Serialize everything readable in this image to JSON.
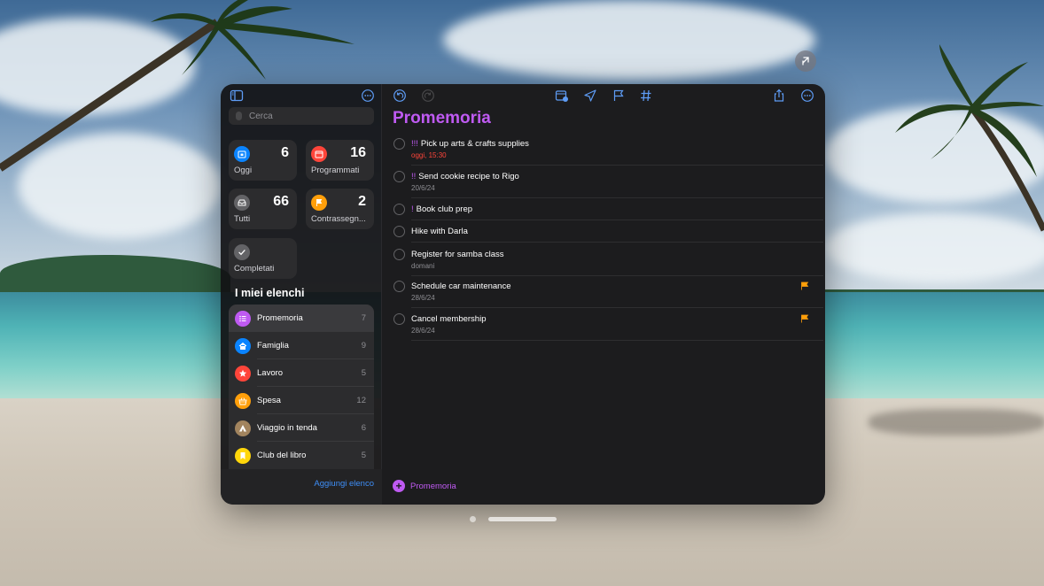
{
  "sidebar": {
    "search_placeholder": "Cerca",
    "tiles": [
      {
        "label": "Oggi",
        "count": "6",
        "color": "#0a84ff",
        "icon": "calendar-today-icon"
      },
      {
        "label": "Programmati",
        "count": "16",
        "color": "#ff453a",
        "icon": "calendar-icon"
      },
      {
        "label": "Tutti",
        "count": "66",
        "color": "#8e8e93",
        "icon": "tray-icon"
      },
      {
        "label": "Contrassegnati",
        "display_label": "Contrassegn...",
        "count": "2",
        "color": "#ff9f0a",
        "icon": "flag-icon"
      },
      {
        "label": "Completati",
        "count": "",
        "color": "#8e8e93",
        "icon": "checkmark-icon"
      }
    ],
    "section_title": "I miei elenchi",
    "lists": [
      {
        "name": "Promemoria",
        "count": "7",
        "color": "#bf5af2",
        "icon": "list-bullet-icon"
      },
      {
        "name": "Famiglia",
        "count": "9",
        "color": "#0a84ff",
        "icon": "house-icon"
      },
      {
        "name": "Lavoro",
        "count": "5",
        "color": "#ff453a",
        "icon": "star-icon"
      },
      {
        "name": "Spesa",
        "count": "12",
        "color": "#ff9f0a",
        "icon": "basket-icon"
      },
      {
        "name": "Viaggio in tenda",
        "count": "6",
        "color": "#a2845e",
        "icon": "tent-icon"
      },
      {
        "name": "Club del libro",
        "count": "5",
        "color": "#ffd60a",
        "icon": "bookmark-icon"
      }
    ],
    "add_list_label": "Aggiungi elenco"
  },
  "main": {
    "title": "Promemoria",
    "reminders": [
      {
        "priority": "!!!",
        "title": "Pick up arts & crafts supplies",
        "subtitle": "oggi, 15:30",
        "subtitle_red": true,
        "flagged": false
      },
      {
        "priority": "!!",
        "title": "Send cookie recipe to Rigo",
        "subtitle": "20/6/24",
        "subtitle_red": false,
        "flagged": false
      },
      {
        "priority": "!",
        "title": "Book club prep",
        "subtitle": "",
        "subtitle_red": false,
        "flagged": false
      },
      {
        "priority": "",
        "title": "Hike with Darla",
        "subtitle": "",
        "subtitle_red": false,
        "flagged": false
      },
      {
        "priority": "",
        "title": "Register for samba class",
        "subtitle": "domani",
        "subtitle_red": false,
        "flagged": false
      },
      {
        "priority": "",
        "title": "Schedule car maintenance",
        "subtitle": "28/6/24",
        "subtitle_red": false,
        "flagged": true
      },
      {
        "priority": "",
        "title": "Cancel membership",
        "subtitle": "28/6/24",
        "subtitle_red": false,
        "flagged": true
      }
    ],
    "new_reminder_label": "Promemoria"
  },
  "colors": {
    "accent": "#bf5af2",
    "link": "#3e8ef7",
    "toolbar_icon": "#5e9cf5",
    "flag": "#ff9f0a"
  }
}
